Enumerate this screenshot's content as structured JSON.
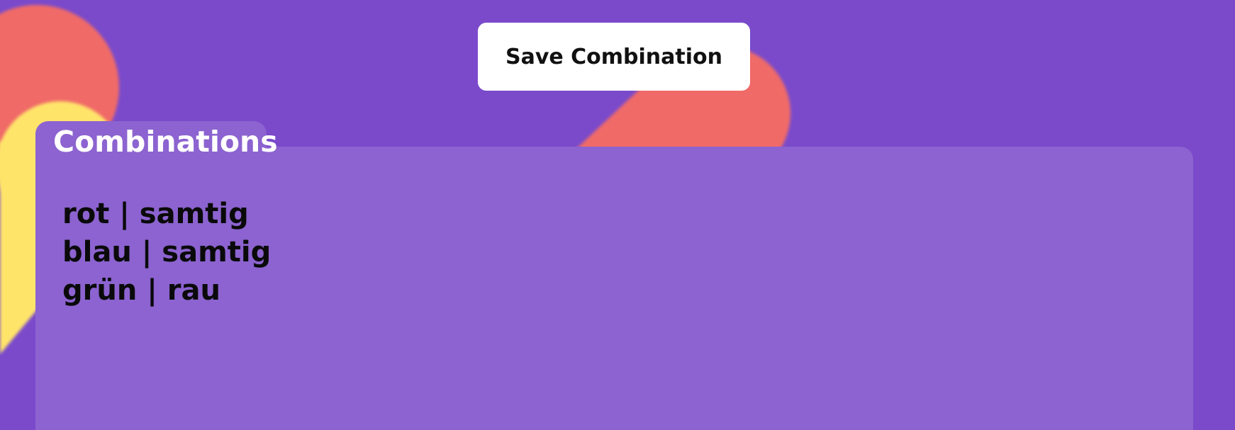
{
  "actions": {
    "save_label": "Save Combination"
  },
  "panel": {
    "title": "Combinations",
    "items": [
      {
        "label": "rot | samtig"
      },
      {
        "label": "blau | samtig"
      },
      {
        "label": "grün | rau"
      }
    ]
  },
  "colors": {
    "background": "#7a4acb",
    "panel": "#8c63d0",
    "shape_coral": "#f06a68",
    "shape_yellow": "#ffe46a",
    "button": "#ffffff",
    "text_dark": "#0a0a0a",
    "text_light": "#ffffff"
  }
}
